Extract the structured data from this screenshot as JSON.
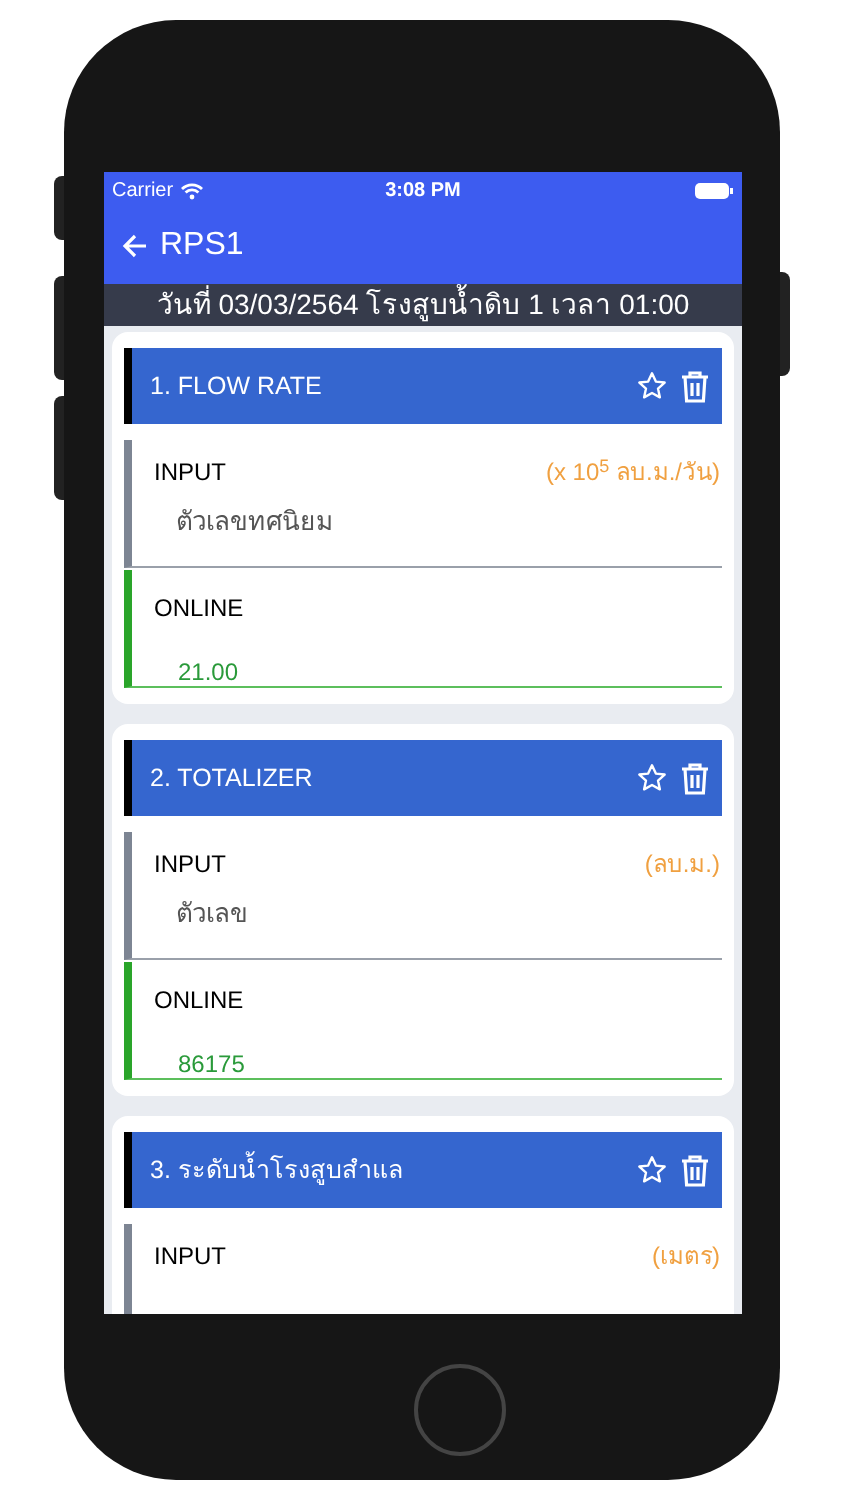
{
  "status_bar": {
    "carrier": "Carrier",
    "time": "3:08 PM"
  },
  "header": {
    "title": "RPS1"
  },
  "date_bar": "วันที่ 03/03/2564 โรงสูบน้ำดิบ 1 เวลา 01:00",
  "cards": [
    {
      "title": "1.  FLOW RATE",
      "starred": false,
      "input": {
        "label": "INPUT",
        "unit": "(x 10$^{5}$ ลบ.ม./วัน)",
        "placeholder": "ตัวเลขทศนิยม"
      },
      "online": {
        "label": "ONLINE",
        "value": "21.00"
      }
    },
    {
      "title": "2.  TOTALIZER",
      "starred": false,
      "input": {
        "label": "INPUT",
        "unit": "(ลบ.ม.)",
        "placeholder": "ตัวเลข"
      },
      "online": {
        "label": "ONLINE",
        "value": "86175"
      }
    },
    {
      "title": "3.  ระดับน้ำโรงสูบสำแล",
      "starred": false,
      "input": {
        "label": "INPUT",
        "unit": "(เมตร)"
      }
    }
  ]
}
